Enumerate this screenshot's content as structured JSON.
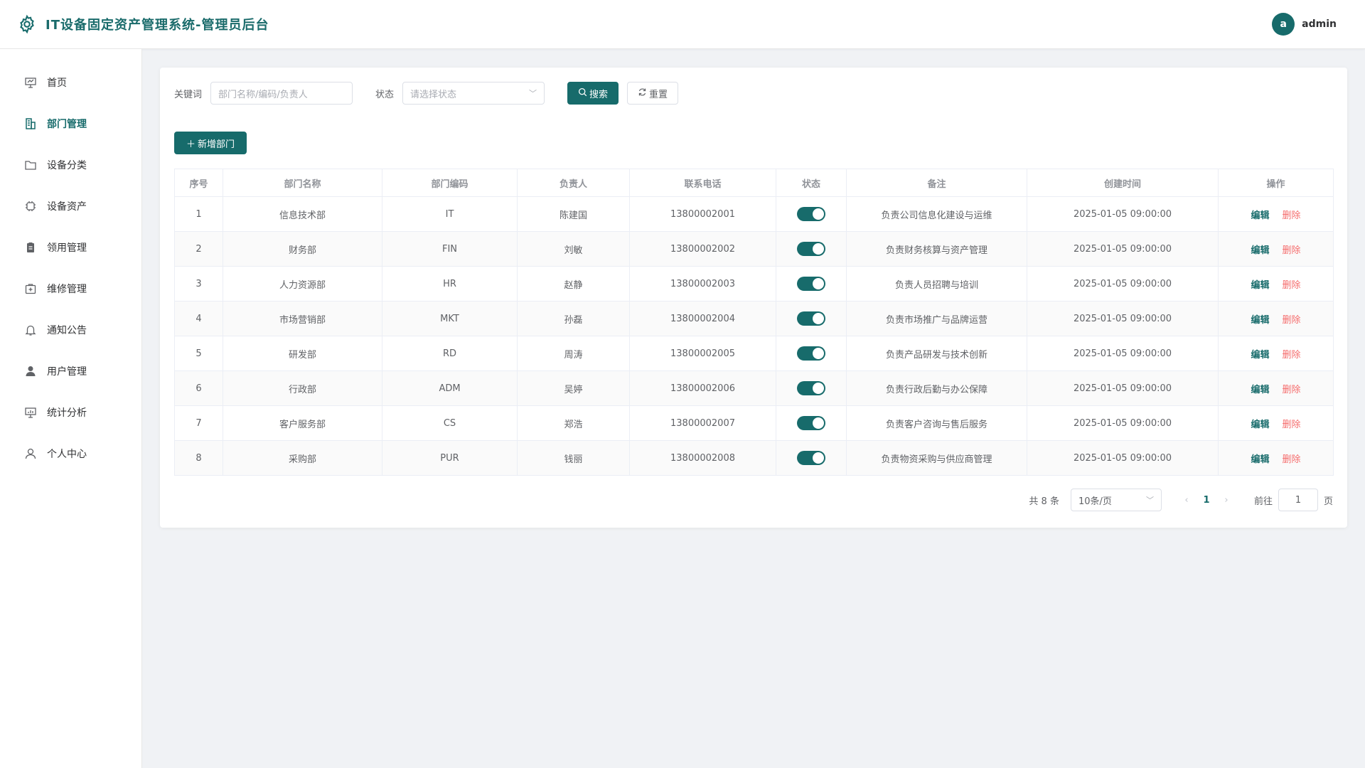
{
  "header": {
    "title": "IT设备固定资产管理系统-管理员后台",
    "avatar_letter": "a",
    "username": "admin"
  },
  "sidebar": {
    "items": [
      {
        "label": "首页",
        "icon": "presentation-icon",
        "active": false
      },
      {
        "label": "部门管理",
        "icon": "building-icon",
        "active": true
      },
      {
        "label": "设备分类",
        "icon": "folder-icon",
        "active": false
      },
      {
        "label": "设备资产",
        "icon": "chip-icon",
        "active": false
      },
      {
        "label": "领用管理",
        "icon": "clipboard-icon",
        "active": false
      },
      {
        "label": "维修管理",
        "icon": "first-aid-icon",
        "active": false
      },
      {
        "label": "通知公告",
        "icon": "bell-icon",
        "active": false
      },
      {
        "label": "用户管理",
        "icon": "user-filled-icon",
        "active": false
      },
      {
        "label": "统计分析",
        "icon": "chart-board-icon",
        "active": false
      },
      {
        "label": "个人中心",
        "icon": "user-outline-icon",
        "active": false
      }
    ]
  },
  "filters": {
    "keyword_label": "关键词",
    "keyword_placeholder": "部门名称/编码/负责人",
    "status_label": "状态",
    "status_placeholder": "请选择状态",
    "search_label": "搜索",
    "reset_label": "重置"
  },
  "add_button": "新增部门",
  "table": {
    "columns": [
      "序号",
      "部门名称",
      "部门编码",
      "负责人",
      "联系电话",
      "状态",
      "备注",
      "创建时间",
      "操作"
    ],
    "edit_label": "编辑",
    "delete_label": "删除",
    "rows": [
      {
        "no": "1",
        "name": "信息技术部",
        "code": "IT",
        "owner": "陈建国",
        "phone": "13800002001",
        "enabled": true,
        "remark": "负责公司信息化建设与运维",
        "created": "2025-01-05 09:00:00"
      },
      {
        "no": "2",
        "name": "财务部",
        "code": "FIN",
        "owner": "刘敏",
        "phone": "13800002002",
        "enabled": true,
        "remark": "负责财务核算与资产管理",
        "created": "2025-01-05 09:00:00"
      },
      {
        "no": "3",
        "name": "人力资源部",
        "code": "HR",
        "owner": "赵静",
        "phone": "13800002003",
        "enabled": true,
        "remark": "负责人员招聘与培训",
        "created": "2025-01-05 09:00:00"
      },
      {
        "no": "4",
        "name": "市场营销部",
        "code": "MKT",
        "owner": "孙磊",
        "phone": "13800002004",
        "enabled": true,
        "remark": "负责市场推广与品牌运营",
        "created": "2025-01-05 09:00:00"
      },
      {
        "no": "5",
        "name": "研发部",
        "code": "RD",
        "owner": "周涛",
        "phone": "13800002005",
        "enabled": true,
        "remark": "负责产品研发与技术创新",
        "created": "2025-01-05 09:00:00"
      },
      {
        "no": "6",
        "name": "行政部",
        "code": "ADM",
        "owner": "吴婷",
        "phone": "13800002006",
        "enabled": true,
        "remark": "负责行政后勤与办公保障",
        "created": "2025-01-05 09:00:00"
      },
      {
        "no": "7",
        "name": "客户服务部",
        "code": "CS",
        "owner": "郑浩",
        "phone": "13800002007",
        "enabled": true,
        "remark": "负责客户咨询与售后服务",
        "created": "2025-01-05 09:00:00"
      },
      {
        "no": "8",
        "name": "采购部",
        "code": "PUR",
        "owner": "钱丽",
        "phone": "13800002008",
        "enabled": true,
        "remark": "负责物资采购与供应商管理",
        "created": "2025-01-05 09:00:00"
      }
    ]
  },
  "pagination": {
    "total_text": "共 8 条",
    "page_size": "10条/页",
    "current_page": "1",
    "goto_label": "前往",
    "goto_value": "1",
    "page_suffix": "页"
  },
  "colors": {
    "primary": "#176b6b",
    "danger": "#f56c6c"
  }
}
